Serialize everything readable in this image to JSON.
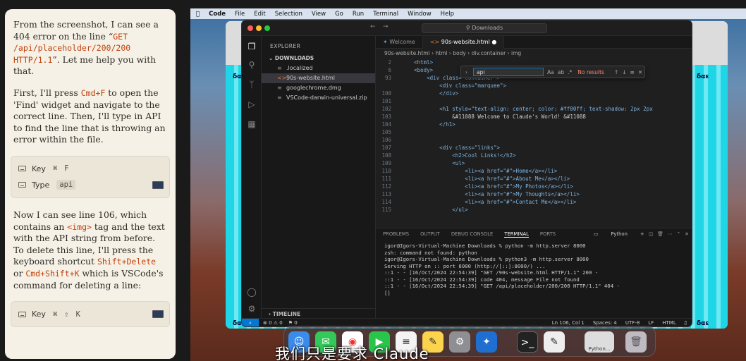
{
  "chat": {
    "msg1_pre": "From the screenshot, I can see a 404 error on the line “",
    "msg1_code": "GET /api/placeholder/200/200 HTTP/1.1",
    "msg1_post": "”. Let me help you with that.",
    "msg2_pre": "First, I'll press ",
    "msg2_code": "Cmd+F",
    "msg2_post": " to open the 'Find' widget and navigate to the correct line. Then, I'll type in API to find the line that is throwing an error within the file.",
    "action1": {
      "key_label": "Key",
      "key1": "⌘",
      "key2": "F",
      "type_label": "Type",
      "type_value": "api"
    },
    "msg3_a": "Now I can see line 106, which contains an ",
    "msg3_code1": "<img>",
    "msg3_b": " tag and the text with the API string from before. To delete this line, I'll press the keyboard shortcut ",
    "msg3_code2": "Shift+Delete",
    "msg3_c": " or ",
    "msg3_code3": "Cmd+Shift+K",
    "msg3_d": " which is VSCode's command for deleting a line:",
    "action2": {
      "key_label": "Key",
      "key1": "⌘",
      "key2": "⇧",
      "key3": "K"
    }
  },
  "menubar": {
    "app": "Code",
    "items": [
      "File",
      "Edit",
      "Selection",
      "View",
      "Go",
      "Run",
      "Terminal",
      "Window",
      "Help"
    ]
  },
  "browser": {
    "side_label": "δαε"
  },
  "vscode": {
    "command_center": "Downloads",
    "explorer_title": "EXPLORER",
    "folder": "DOWNLOADS",
    "files": [
      ".localized",
      "90s-website.html",
      "googlechrome.dmg",
      "VSCode-darwin-universal.zip"
    ],
    "timeline": "TIMELINE",
    "tabs": [
      "Welcome",
      "90s-website.html"
    ],
    "breadcrumb": "90s-website.html › html › body › div.container › img",
    "find": {
      "value": "api",
      "opt1": "Aa",
      "opt2": "ab",
      "opt3": ".*",
      "result": "No results"
    },
    "code_lines": [
      {
        "n": "2",
        "t": "    <html>"
      },
      {
        "n": "6",
        "t": "    <body>"
      },
      {
        "n": "93",
        "t": "        <div class=\"container\">"
      },
      {
        "n": "",
        "t": "            <div class=\"marquee\">"
      },
      {
        "n": "100",
        "t": "            </div>"
      },
      {
        "n": "101",
        "t": ""
      },
      {
        "n": "102",
        "t": "            <h1 style=\"text-align: center; color: #ff00ff; text-shadow: 2px 2px"
      },
      {
        "n": "103",
        "t": "                &#11088 Welcome to Claude's World! &#11088"
      },
      {
        "n": "104",
        "t": "            </h1>"
      },
      {
        "n": "105",
        "t": ""
      },
      {
        "n": "106",
        "t": ""
      },
      {
        "n": "107",
        "t": "            <div class=\"links\">"
      },
      {
        "n": "108",
        "t": "                <h2>Cool Links!</h2>"
      },
      {
        "n": "109",
        "t": "                <ul>"
      },
      {
        "n": "110",
        "t": "                    <li><a href=\"#\">Home</a></li>"
      },
      {
        "n": "111",
        "t": "                    <li><a href=\"#\">About Me</a></li>"
      },
      {
        "n": "112",
        "t": "                    <li><a href=\"#\">My Photos</a></li>"
      },
      {
        "n": "113",
        "t": "                    <li><a href=\"#\">My Thoughts</a></li>"
      },
      {
        "n": "114",
        "t": "                    <li><a href=\"#\">Contact Me</a></li>"
      },
      {
        "n": "115",
        "t": "                </ul>"
      }
    ],
    "panel_tabs": [
      "PROBLEMS",
      "OUTPUT",
      "DEBUG CONSOLE",
      "TERMINAL",
      "PORTS"
    ],
    "terminal_kind": "Python",
    "terminal_lines": [
      "igor@Igors-Virtual-Machine Downloads % python -m http.server 8000",
      "zsh: command not found: python",
      "igor@Igors-Virtual-Machine Downloads % python3 -m http.server 8000",
      "Serving HTTP on :: port 8000 (http://[::]:8000/) ...",
      "::1 - - [16/Oct/2024 22:54:39] \"GET /90s-website.html HTTP/1.1\" 200 -",
      "::1 - - [16/Oct/2024 22:54:39] code 404, message File not found",
      "::1 - - [16/Oct/2024 22:54:39] \"GET /api/placeholder/200/200 HTTP/1.1\" 404 -",
      "[]"
    ],
    "status": {
      "errors": "⊗ 0 ⚠ 0",
      "ports": "⚑ 0",
      "position": "Ln 106, Col 1",
      "spaces": "Spaces: 4",
      "encoding": "UTF-8",
      "eol": "LF",
      "lang": "HTML"
    }
  },
  "dock": {
    "python_label": "Python..."
  },
  "subtitle": "我们只是要求 Claude"
}
